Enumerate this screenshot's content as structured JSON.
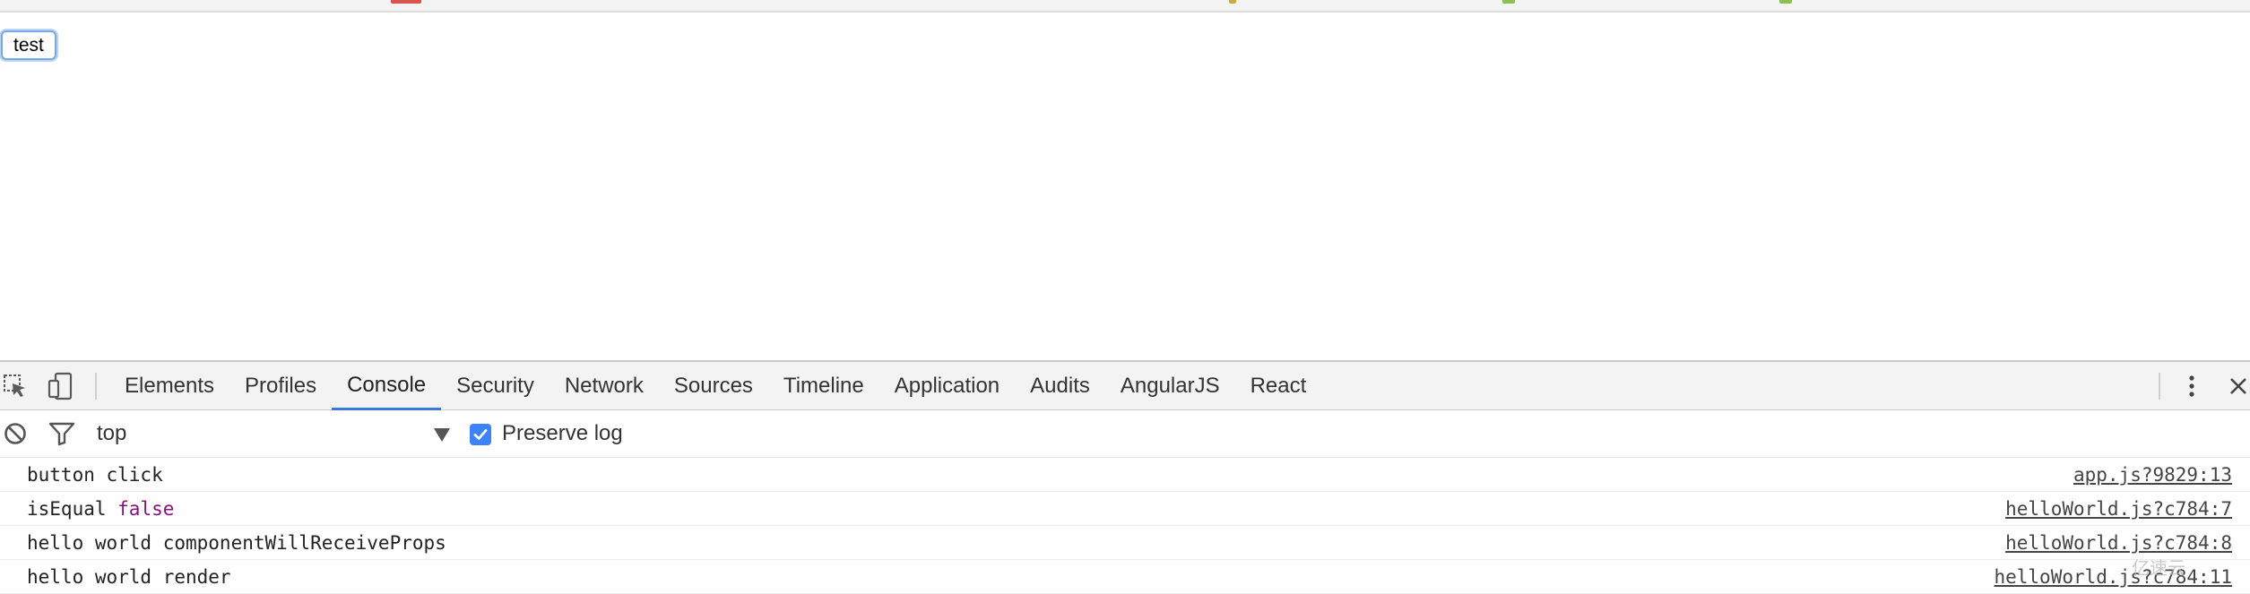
{
  "colors": {
    "active_tab_underline": "#3879d9",
    "checkbox_fill": "#3e82f7",
    "keyword": "#881280",
    "strip_marks": [
      "#d9534f",
      "#c9b037",
      "#8cc152",
      "#8cc152"
    ]
  },
  "page": {
    "test_button_label": "test"
  },
  "devtools": {
    "icons": {
      "inspect": "inspect-cursor-icon",
      "device": "device-toolbar-icon",
      "more": "kebab-menu-icon",
      "close": "close-icon",
      "clear": "clear-console-icon",
      "filter": "filter-icon"
    },
    "tabs": [
      {
        "label": "Elements",
        "active": false
      },
      {
        "label": "Profiles",
        "active": false
      },
      {
        "label": "Console",
        "active": true
      },
      {
        "label": "Security",
        "active": false
      },
      {
        "label": "Network",
        "active": false
      },
      {
        "label": "Sources",
        "active": false
      },
      {
        "label": "Timeline",
        "active": false
      },
      {
        "label": "Application",
        "active": false
      },
      {
        "label": "Audits",
        "active": false
      },
      {
        "label": "AngularJS",
        "active": false
      },
      {
        "label": "React",
        "active": false
      }
    ],
    "filter": {
      "context": "top",
      "preserve_log_label": "Preserve log",
      "preserve_log_checked": true
    },
    "console": [
      {
        "text": "button click",
        "keyword": "",
        "source": "app.js?9829:13"
      },
      {
        "text": "isEqual ",
        "keyword": "false",
        "source": "helloWorld.js?c784:7"
      },
      {
        "text": "hello world componentWillReceiveProps",
        "keyword": "",
        "source": "helloWorld.js?c784:8"
      },
      {
        "text": "hello world render",
        "keyword": "",
        "source": "helloWorld.js?c784:11"
      }
    ]
  },
  "watermark": "亿速云"
}
